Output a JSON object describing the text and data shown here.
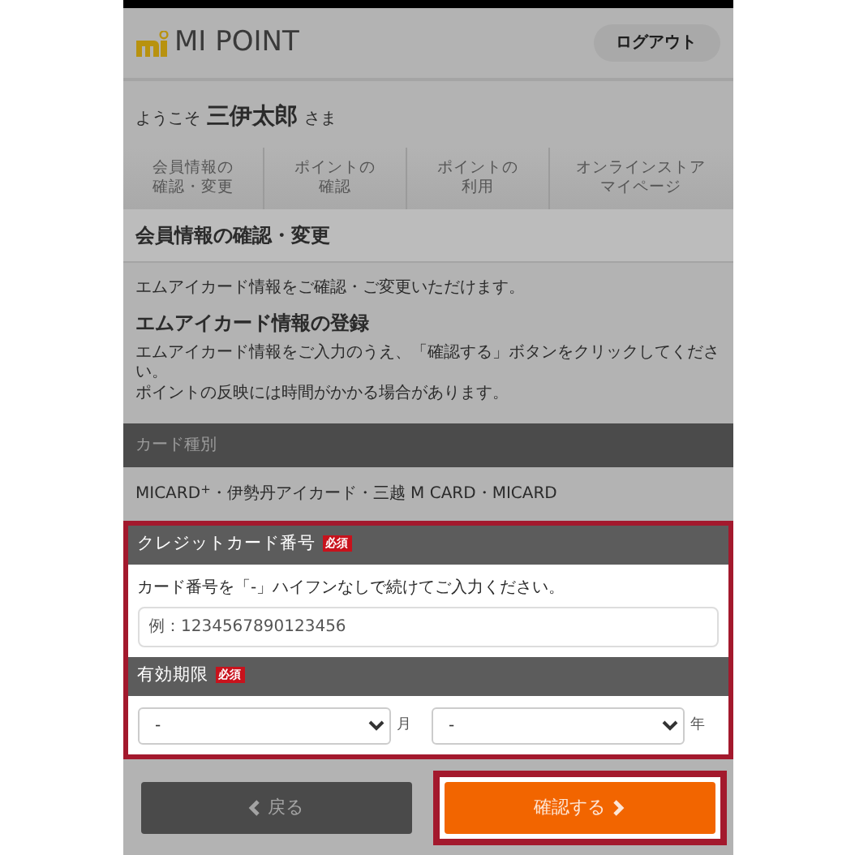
{
  "header": {
    "brand": "MI POINT",
    "logout": "ログアウト"
  },
  "welcome": {
    "prefix": "ようこそ",
    "name": "三伊太郎",
    "suffix": "さま"
  },
  "tabs": [
    {
      "lines": [
        "会員情報の",
        "確認・変更"
      ],
      "selected": false
    },
    {
      "lines": [
        "ポイントの",
        "確認"
      ],
      "selected": false
    },
    {
      "lines": [
        "ポイントの",
        "利用"
      ],
      "selected": false
    },
    {
      "lines": [
        "オンラインストア",
        "マイページ"
      ],
      "selected": false
    }
  ],
  "section_title": "会員情報の確認・変更",
  "intro": "エムアイカード情報をご確認・ご変更いただけます。",
  "subtitle": "エムアイカード情報の登録",
  "instructions": [
    "エムアイカード情報をご入力のうえ、「確認する」ボタンをクリックしてください。",
    "ポイントの反映には時間がかかる場合があります。"
  ],
  "card_type": {
    "heading": "カード種別",
    "value": "MICARD$^{+}$・伊勢丹アイカード・三越 M CARD・MICARD"
  },
  "form": {
    "highlighted": true,
    "card_number": {
      "heading": "クレジットカード番号",
      "required": "必須",
      "hint": "カード番号を「-」ハイフンなしで続けてご入力ください。",
      "placeholder": "例：1234567890123456"
    },
    "expiry": {
      "heading": "有効期限",
      "required": "必須",
      "month": {
        "value": "-",
        "unit": "月"
      },
      "year": {
        "value": "-",
        "unit": "年"
      }
    }
  },
  "buttons": [
    {
      "kind": "back",
      "label": "戻る",
      "highlighted": false
    },
    {
      "kind": "confirm",
      "label": "確認する",
      "highlighted": true
    }
  ]
}
